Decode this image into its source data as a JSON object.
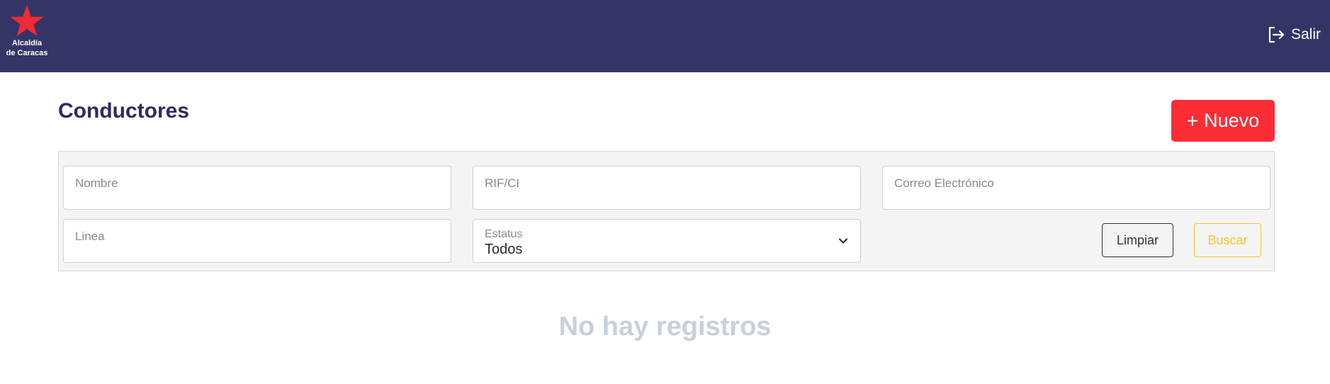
{
  "header": {
    "logo_line1": "Alcaldía",
    "logo_line2": "de Caracas",
    "logout_label": "Salir",
    "logo_icon": "star-icon",
    "logout_icon": "logout-icon"
  },
  "page": {
    "title": "Conductores",
    "new_button": {
      "plus": "+",
      "label": "Nuevo"
    }
  },
  "filters": {
    "name_placeholder": "Nombre",
    "rif_placeholder": "RIF/CI",
    "email_placeholder": "Correo Electrónico",
    "line_placeholder": "Linea",
    "status_label": "Estatus",
    "status_value": "Todos",
    "clear_label": "Limpiar",
    "search_label": "Buscar"
  },
  "results": {
    "empty_message": "No hay registros"
  },
  "colors": {
    "topbar": "#343466",
    "accent_red": "#fd2d36",
    "title": "#2c2c5e",
    "search_yellow": "#f4c430",
    "empty_text": "#c8d0dc"
  }
}
